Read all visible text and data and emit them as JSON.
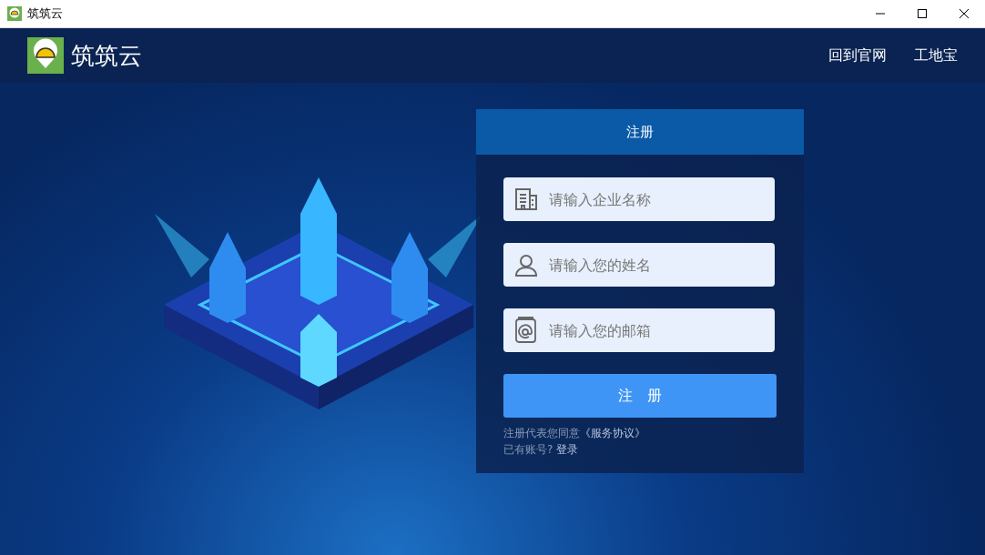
{
  "window": {
    "title": "筑筑云"
  },
  "header": {
    "logo_text": "筑筑云",
    "nav": [
      "回到官网",
      "工地宝"
    ]
  },
  "form": {
    "tab": "注册",
    "fields": [
      {
        "kind": "building",
        "placeholder": "请输入企业名称"
      },
      {
        "kind": "person",
        "placeholder": "请输入您的姓名"
      },
      {
        "kind": "email",
        "placeholder": "请输入您的邮箱"
      }
    ],
    "submit": "注　册",
    "agreement": {
      "text": "注册代表您同意",
      "link": "《服务协议》"
    },
    "login": {
      "text": "已有账号?",
      "link": "登录"
    }
  }
}
